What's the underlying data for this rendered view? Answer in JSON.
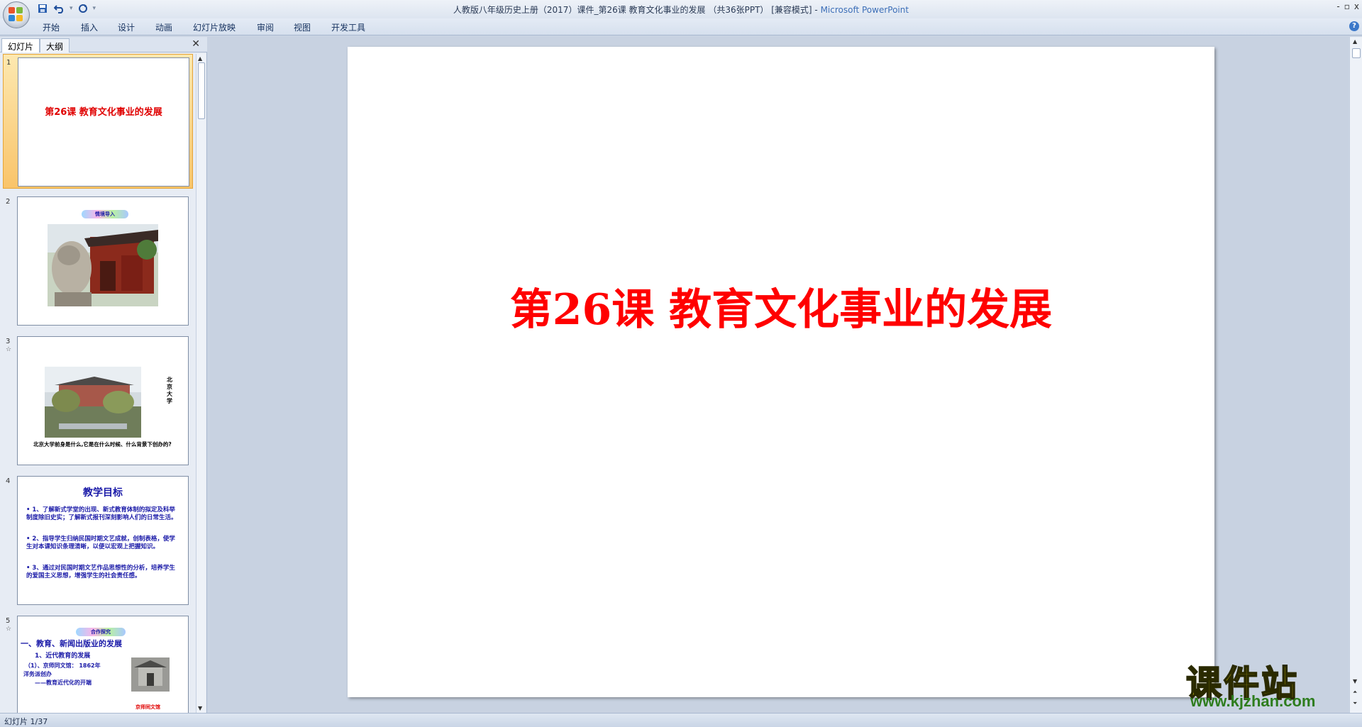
{
  "window": {
    "title": "人教版八年级历史上册（2017）课件_第26课 教育文化事业的发展 （共36张PPT） [兼容模式]",
    "title_sep": " - ",
    "app_name": "Microsoft PowerPoint",
    "controls": [
      "-",
      "▫",
      "x"
    ]
  },
  "qat": {
    "save": "save-icon",
    "undo": "undo-icon",
    "redo": "redo-icon",
    "more": "▾"
  },
  "ribbon": {
    "tabs": [
      "开始",
      "插入",
      "设计",
      "动画",
      "幻灯片放映",
      "审阅",
      "视图",
      "开发工具"
    ],
    "help": "?"
  },
  "panel": {
    "tabs": [
      "幻灯片",
      "大纲"
    ],
    "close": "✕"
  },
  "slides": [
    {
      "num": "1",
      "title": "第26课 教育文化事业的发展"
    },
    {
      "num": "2",
      "banner": "情境导入"
    },
    {
      "num": "3",
      "side": "北京大学",
      "caption": "北京大学前身是什么,它是在什么时候、什么背景下创办的?"
    },
    {
      "num": "4",
      "heading": "教学目标",
      "points": [
        "1、了解新式学堂的出现、新式教育体制的拟定及科举制度除旧史实；了解新式报刊深刻影响人们的日常生活。",
        "2、指导学生归纳民国时期文艺成就，创制表格，使学生对本课知识条理清晰，以便以宏观上把握知识。",
        "3、通过对民国时期文艺作品思想性的分析，培养学生的爱国主义思想，增强学生的社会责任感。"
      ]
    },
    {
      "num": "5",
      "banner": "合作探究",
      "heading": "一、教育、新闻出版业的发展",
      "sub": "1、近代教育的发展",
      "line1": "（1）、京师同文馆： 1862年",
      "line2": "洋务派创办",
      "line3": "——教育近代化的开端",
      "photo_caption": "京师同文馆"
    }
  ],
  "main_slide": {
    "title": "第26课  教育文化事业的发展"
  },
  "watermark": {
    "cn": "课件站",
    "en": "www.kjzhan.com"
  },
  "status": {
    "slide_counter": "幻灯片 1/37"
  }
}
